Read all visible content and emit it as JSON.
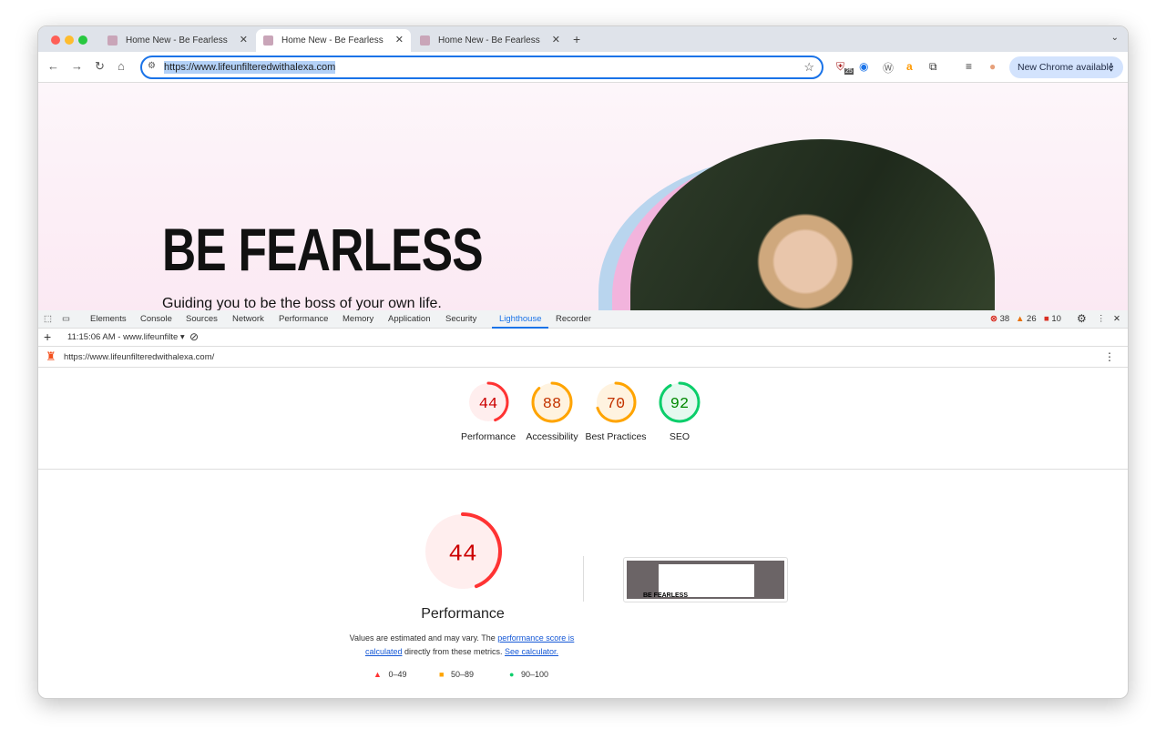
{
  "browser": {
    "tabs": [
      {
        "title": "Home New - Be Fearless",
        "active": false
      },
      {
        "title": "Home New - Be Fearless",
        "active": true
      },
      {
        "title": "Home New - Be Fearless",
        "active": false
      }
    ],
    "url": "https://www.lifeunfilteredwithalexa.com",
    "extension_badge": "25",
    "new_chrome_label": "New Chrome available"
  },
  "page": {
    "hero_title": "BE FEARLESS",
    "hero_subtitle": "Guiding you to be the boss of your own life."
  },
  "devtools": {
    "tabs": [
      "Elements",
      "Console",
      "Sources",
      "Network",
      "Performance",
      "Memory",
      "Application",
      "Security",
      "Lighthouse",
      "Recorder"
    ],
    "active_tab": "Lighthouse",
    "errors": "38",
    "warnings": "26",
    "issues": "10",
    "report_selector": "11:15:06 AM - www.lifeunfilte",
    "report_url": "https://www.lifeunfilteredwithalexa.com/"
  },
  "lighthouse": {
    "scores": [
      {
        "label": "Performance",
        "value": 44,
        "color": "#ff3333"
      },
      {
        "label": "Accessibility",
        "value": 88,
        "color": "#ffa400"
      },
      {
        "label": "Best Practices",
        "value": 70,
        "color": "#ffa400"
      },
      {
        "label": "SEO",
        "value": 92,
        "color": "#0cce6b"
      }
    ],
    "main_score": 44,
    "main_label": "Performance",
    "note_prefix": "Values are estimated and may vary. The ",
    "note_link1": "performance score is calculated",
    "note_middle": " directly from these metrics. ",
    "note_link2": "See calculator.",
    "legend": [
      {
        "range": "0–49",
        "color": "#ff3333",
        "shape": "triangle"
      },
      {
        "range": "50–89",
        "color": "#ffa400",
        "shape": "square"
      },
      {
        "range": "90–100",
        "color": "#0cce6b",
        "shape": "circle"
      }
    ],
    "thumbnail_text": "BE FEARLESS"
  }
}
